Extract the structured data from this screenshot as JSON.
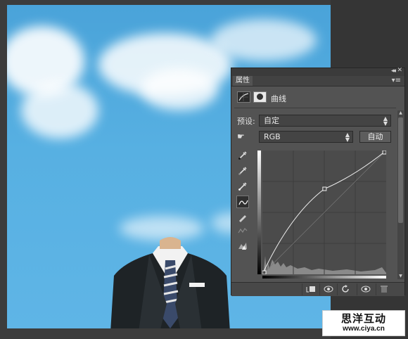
{
  "panel": {
    "tab_label": "属性",
    "title": "曲线",
    "preset_label": "预设:",
    "preset_value": "自定",
    "channel_value": "RGB",
    "auto_button": "自动",
    "icons": {
      "adjustment": "curves-adjustment-icon",
      "mask": "layer-mask-icon",
      "hand": "targeted-adjustment-hand-icon",
      "tools": [
        "black-point-eyedropper-icon",
        "gray-point-eyedropper-icon",
        "white-point-eyedropper-icon",
        "curve-point-tool-icon",
        "pencil-icon",
        "smooth-icon",
        "clipping-warning-icon"
      ],
      "bottom": [
        "clip-to-layer-icon",
        "view-previous-state-icon",
        "reset-icon",
        "visibility-eye-icon",
        "delete-trash-icon"
      ]
    }
  },
  "curve": {
    "input_range": [
      0,
      255
    ],
    "output_range": [
      0,
      255
    ],
    "points": [
      [
        0,
        0
      ],
      [
        128,
        176
      ],
      [
        255,
        255
      ]
    ]
  },
  "watermark": {
    "title": "思洋互动",
    "url": "www.ciya.cn"
  },
  "colors": {
    "sky": "#57b0e2",
    "panel": "#535353",
    "background": "#3c3c3c"
  }
}
